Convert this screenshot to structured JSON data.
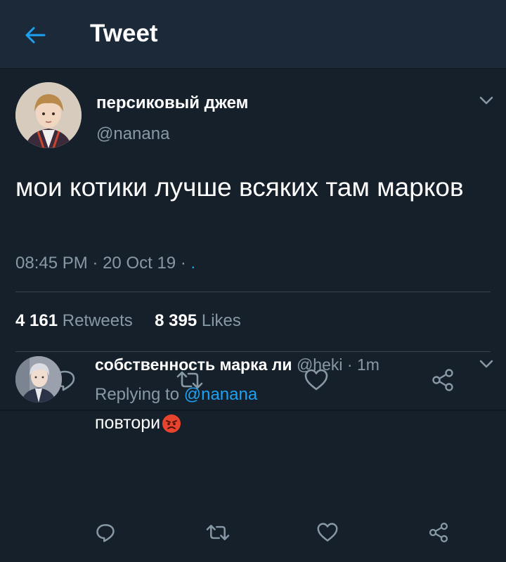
{
  "header": {
    "title": "Tweet",
    "back_icon": "arrow-left-icon"
  },
  "tweet": {
    "display_name": "персиковый джем",
    "handle": "@nanana",
    "text": "мои котики лучше всяких там марков",
    "time": "08:45 PM",
    "date": "20 Oct 19",
    "source": ".",
    "retweets_count": "4 161",
    "retweets_label": "Retweets",
    "likes_count": "8 395",
    "likes_label": "Likes"
  },
  "reply": {
    "display_name": "собственность марка ли",
    "handle": "@heki",
    "time_ago": "1m",
    "replying_prefix": "Replying to",
    "replying_to": "@nanana",
    "text": "повтори"
  },
  "colors": {
    "background": "#15202b",
    "header": "#1c2938",
    "accent": "#1da1f2",
    "secondary_text": "#8899a6",
    "divider": "#38444d"
  },
  "icons": [
    "reply-icon",
    "retweet-icon",
    "like-icon",
    "share-icon",
    "chevron-down-icon",
    "angry-face-emoji"
  ]
}
